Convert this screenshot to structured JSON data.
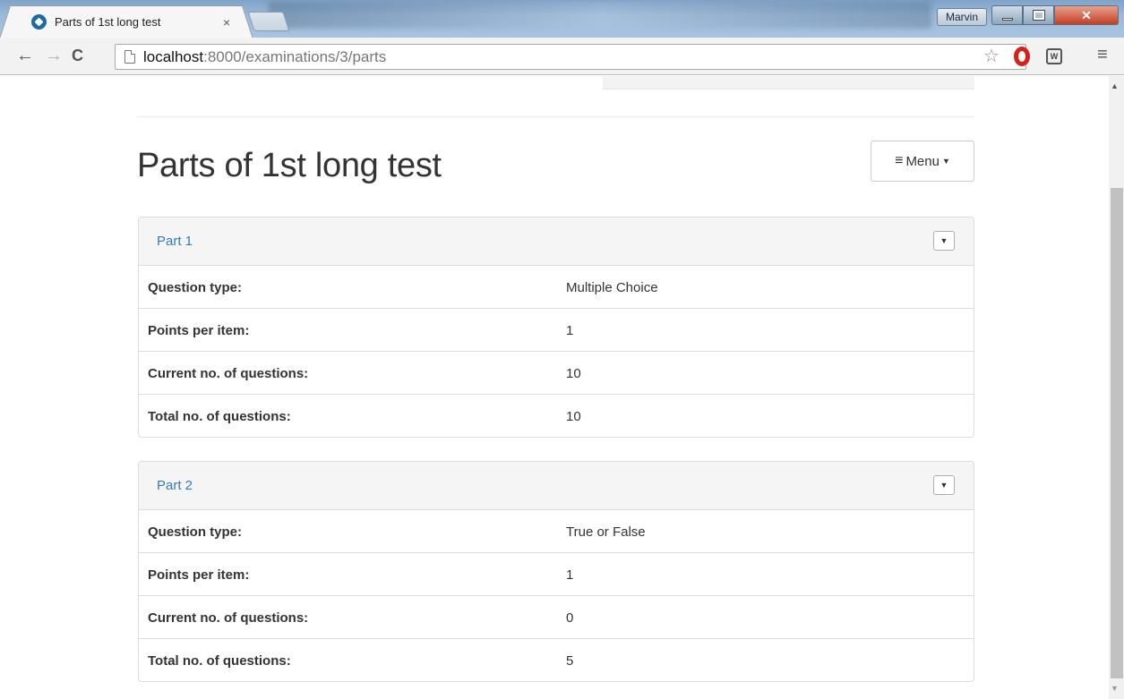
{
  "browser": {
    "tab_title": "Parts of 1st long test",
    "tab_close": "×",
    "user_name": "Marvin",
    "url_host": "localhost",
    "url_rest": ":8000/examinations/3/parts"
  },
  "page": {
    "title": "Parts of 1st long test",
    "menu_label": "Menu"
  },
  "parts": [
    {
      "title": "Part 1",
      "rows": [
        {
          "label": "Question type:",
          "value": "Multiple Choice"
        },
        {
          "label": "Points per item:",
          "value": "1"
        },
        {
          "label": "Current no. of questions:",
          "value": "10"
        },
        {
          "label": "Total no. of questions:",
          "value": "10"
        }
      ]
    },
    {
      "title": "Part 2",
      "rows": [
        {
          "label": "Question type:",
          "value": "True or False"
        },
        {
          "label": "Points per item:",
          "value": "1"
        },
        {
          "label": "Current no. of questions:",
          "value": "0"
        },
        {
          "label": "Total no. of questions:",
          "value": "5"
        }
      ]
    }
  ],
  "icons": {
    "back": "back-arrow-icon",
    "forward": "forward-arrow-icon",
    "reload": "reload-icon",
    "star": "star-icon",
    "opera": "opera-icon",
    "extension": "extension-icon",
    "chrome_menu": "hamburger-icon",
    "caret": "caret-down-icon"
  },
  "colors": {
    "link": "#337ab7",
    "panel_heading": "#f5f5f5",
    "border": "#dddddd"
  }
}
